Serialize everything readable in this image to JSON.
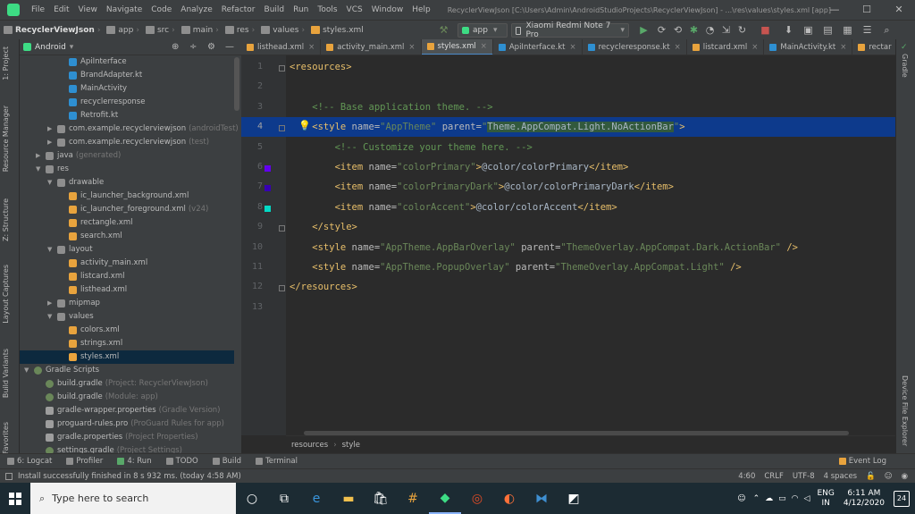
{
  "menubar": {
    "items": [
      "File",
      "Edit",
      "View",
      "Navigate",
      "Code",
      "Analyze",
      "Refactor",
      "Build",
      "Run",
      "Tools",
      "VCS",
      "Window",
      "Help"
    ],
    "title": "RecyclerViewJson [C:\\Users\\Admin\\AndroidStudioProjects\\RecyclerViewJson] - ...\\res\\values\\styles.xml [app]",
    "minimize": "—",
    "maximize": "☐",
    "close": "✕"
  },
  "navbar": {
    "crumbs": [
      "RecyclerViewJson",
      "app",
      "src",
      "main",
      "res",
      "values",
      "styles.xml"
    ],
    "run_config": "app",
    "device": "Xiaomi Redmi Note 7 Pro"
  },
  "left_tool_tabs": [
    "1: Project",
    "Resource Manager",
    "Z: Structure",
    "Layout Captures",
    "Build Variants",
    "Favorites"
  ],
  "right_tool_tabs": [
    "Gradle",
    "Device File Explorer"
  ],
  "project": {
    "view_selector": "Android",
    "tree": [
      {
        "label": "ApiInterface",
        "icon": "kt",
        "depth": 4,
        "suffix": ""
      },
      {
        "label": "BrandAdapter.kt",
        "icon": "kt",
        "depth": 4,
        "suffix": ""
      },
      {
        "label": "MainActivity",
        "icon": "kt",
        "depth": 4,
        "suffix": ""
      },
      {
        "label": "recyclerresponse",
        "icon": "kt",
        "depth": 4,
        "suffix": ""
      },
      {
        "label": "Retrofit.kt",
        "icon": "kt",
        "depth": 4,
        "suffix": ""
      },
      {
        "label": "com.example.recyclerviewjson",
        "icon": "fold",
        "depth": 3,
        "suffix": "(androidTest)",
        "arrow": "▶"
      },
      {
        "label": "com.example.recyclerviewjson",
        "icon": "fold",
        "depth": 3,
        "suffix": "(test)",
        "arrow": "▶"
      },
      {
        "label": "java",
        "icon": "fold",
        "depth": 2,
        "suffix": "(generated)",
        "arrow": "▶"
      },
      {
        "label": "res",
        "icon": "fold",
        "depth": 2,
        "suffix": "",
        "arrow": "▼"
      },
      {
        "label": "drawable",
        "icon": "fold",
        "depth": 3,
        "suffix": "",
        "arrow": "▼"
      },
      {
        "label": "ic_launcher_background.xml",
        "icon": "xml",
        "depth": 4,
        "suffix": ""
      },
      {
        "label": "ic_launcher_foreground.xml",
        "icon": "xml",
        "depth": 4,
        "suffix": "(v24)"
      },
      {
        "label": "rectangle.xml",
        "icon": "xml",
        "depth": 4,
        "suffix": ""
      },
      {
        "label": "search.xml",
        "icon": "xml",
        "depth": 4,
        "suffix": ""
      },
      {
        "label": "layout",
        "icon": "fold",
        "depth": 3,
        "suffix": "",
        "arrow": "▼"
      },
      {
        "label": "activity_main.xml",
        "icon": "xml",
        "depth": 4,
        "suffix": ""
      },
      {
        "label": "listcard.xml",
        "icon": "xml",
        "depth": 4,
        "suffix": ""
      },
      {
        "label": "listhead.xml",
        "icon": "xml",
        "depth": 4,
        "suffix": ""
      },
      {
        "label": "mipmap",
        "icon": "fold",
        "depth": 3,
        "suffix": "",
        "arrow": "▶"
      },
      {
        "label": "values",
        "icon": "fold",
        "depth": 3,
        "suffix": "",
        "arrow": "▼"
      },
      {
        "label": "colors.xml",
        "icon": "xml",
        "depth": 4,
        "suffix": ""
      },
      {
        "label": "strings.xml",
        "icon": "xml",
        "depth": 4,
        "suffix": ""
      },
      {
        "label": "styles.xml",
        "icon": "xml",
        "depth": 4,
        "suffix": "",
        "selected": true
      },
      {
        "label": "Gradle Scripts",
        "icon": "grad",
        "depth": 1,
        "suffix": "",
        "arrow": "▼"
      },
      {
        "label": "build.gradle",
        "icon": "grad",
        "depth": 2,
        "suffix": "(Project: RecyclerViewJson)"
      },
      {
        "label": "build.gradle",
        "icon": "grad",
        "depth": 2,
        "suffix": "(Module: app)"
      },
      {
        "label": "gradle-wrapper.properties",
        "icon": "prop",
        "depth": 2,
        "suffix": "(Gradle Version)"
      },
      {
        "label": "proguard-rules.pro",
        "icon": "prop",
        "depth": 2,
        "suffix": "(ProGuard Rules for app)"
      },
      {
        "label": "gradle.properties",
        "icon": "prop",
        "depth": 2,
        "suffix": "(Project Properties)"
      },
      {
        "label": "settings.gradle",
        "icon": "grad",
        "depth": 2,
        "suffix": "(Project Settings)"
      }
    ]
  },
  "editor_tabs": [
    {
      "label": "listhead.xml",
      "color": "#e8a33d",
      "active": false
    },
    {
      "label": "activity_main.xml",
      "color": "#e8a33d",
      "active": false
    },
    {
      "label": "styles.xml",
      "color": "#e8a33d",
      "active": true
    },
    {
      "label": "ApiInterface.kt",
      "color": "#2e8fd1",
      "active": false
    },
    {
      "label": "recycleresponse.kt",
      "color": "#2e8fd1",
      "active": false
    },
    {
      "label": "listcard.xml",
      "color": "#e8a33d",
      "active": false
    },
    {
      "label": "MainActivity.kt",
      "color": "#2e8fd1",
      "active": false
    },
    {
      "label": "rectar",
      "color": "#e8a33d",
      "active": false
    }
  ],
  "editor": {
    "current_line": 4,
    "line_numbers": [
      "1",
      "2",
      "3",
      "4",
      "5",
      "6",
      "7",
      "8",
      "9",
      "10",
      "11",
      "12",
      "13"
    ],
    "swatches": [
      {
        "line": 6,
        "color": "#6200EE"
      },
      {
        "line": 7,
        "color": "#3700B3"
      },
      {
        "line": 8,
        "color": "#03DAC5"
      }
    ],
    "lines": [
      [
        {
          "c": "tg",
          "t": "<resources>"
        }
      ],
      [],
      [
        {
          "c": "cm",
          "t": "    <!-- Base application theme. -->"
        }
      ],
      [
        {
          "c": "tg",
          "t": "    <style "
        },
        {
          "c": "an",
          "t": "name="
        },
        {
          "c": "av",
          "t": "\"AppTheme\" "
        },
        {
          "c": "an",
          "t": "parent="
        },
        {
          "c": "av",
          "t": "\""
        },
        {
          "c": "hl",
          "t": "Theme.AppCompat.Light.NoActionBar"
        },
        {
          "c": "av",
          "t": "\""
        },
        {
          "c": "tg",
          "t": ">"
        }
      ],
      [
        {
          "c": "cm",
          "t": "        <!-- Customize your theme here. -->"
        }
      ],
      [
        {
          "c": "tg",
          "t": "        <item "
        },
        {
          "c": "an",
          "t": "name="
        },
        {
          "c": "av",
          "t": "\"colorPrimary\""
        },
        {
          "c": "tg",
          "t": ">"
        },
        {
          "c": "tx",
          "t": "@color/colorPrimary"
        },
        {
          "c": "tg",
          "t": "</item>"
        }
      ],
      [
        {
          "c": "tg",
          "t": "        <item "
        },
        {
          "c": "an",
          "t": "name="
        },
        {
          "c": "av",
          "t": "\"colorPrimaryDark\""
        },
        {
          "c": "tg",
          "t": ">"
        },
        {
          "c": "tx",
          "t": "@color/colorPrimaryDark"
        },
        {
          "c": "tg",
          "t": "</item>"
        }
      ],
      [
        {
          "c": "tg",
          "t": "        <item "
        },
        {
          "c": "an",
          "t": "name="
        },
        {
          "c": "av",
          "t": "\"colorAccent\""
        },
        {
          "c": "tg",
          "t": ">"
        },
        {
          "c": "tx",
          "t": "@color/colorAccent"
        },
        {
          "c": "tg",
          "t": "</item>"
        }
      ],
      [
        {
          "c": "tg",
          "t": "    </style>"
        }
      ],
      [
        {
          "c": "tg",
          "t": "    <style "
        },
        {
          "c": "an",
          "t": "name="
        },
        {
          "c": "av",
          "t": "\"AppTheme.AppBarOverlay\" "
        },
        {
          "c": "an",
          "t": "parent="
        },
        {
          "c": "av",
          "t": "\"ThemeOverlay.AppCompat.Dark.ActionBar\" "
        },
        {
          "c": "tg",
          "t": "/>"
        }
      ],
      [
        {
          "c": "tg",
          "t": "    <style "
        },
        {
          "c": "an",
          "t": "name="
        },
        {
          "c": "av",
          "t": "\"AppTheme.PopupOverlay\" "
        },
        {
          "c": "an",
          "t": "parent="
        },
        {
          "c": "av",
          "t": "\"ThemeOverlay.AppCompat.Light\" "
        },
        {
          "c": "tg",
          "t": "/>"
        }
      ],
      [
        {
          "c": "tg",
          "t": "</resources>"
        }
      ],
      []
    ]
  },
  "editor_breadcrumb": [
    "resources",
    "style"
  ],
  "bottom_tools": [
    "6: Logcat",
    "Profiler",
    "4: Run",
    "TODO",
    "Build",
    "Terminal"
  ],
  "event_log": "Event Log",
  "status": {
    "message": "Install successfully finished in 8 s 932 ms. (today 4:58 AM)",
    "position": "4:60",
    "line_sep": "CRLF",
    "encoding": "UTF-8",
    "indent": "4 spaces"
  },
  "taskbar": {
    "search_placeholder": "Type here to search",
    "lang_top": "ENG",
    "lang_bottom": "IN",
    "time": "6:11 AM",
    "date": "4/12/2020",
    "notifications": "24"
  }
}
